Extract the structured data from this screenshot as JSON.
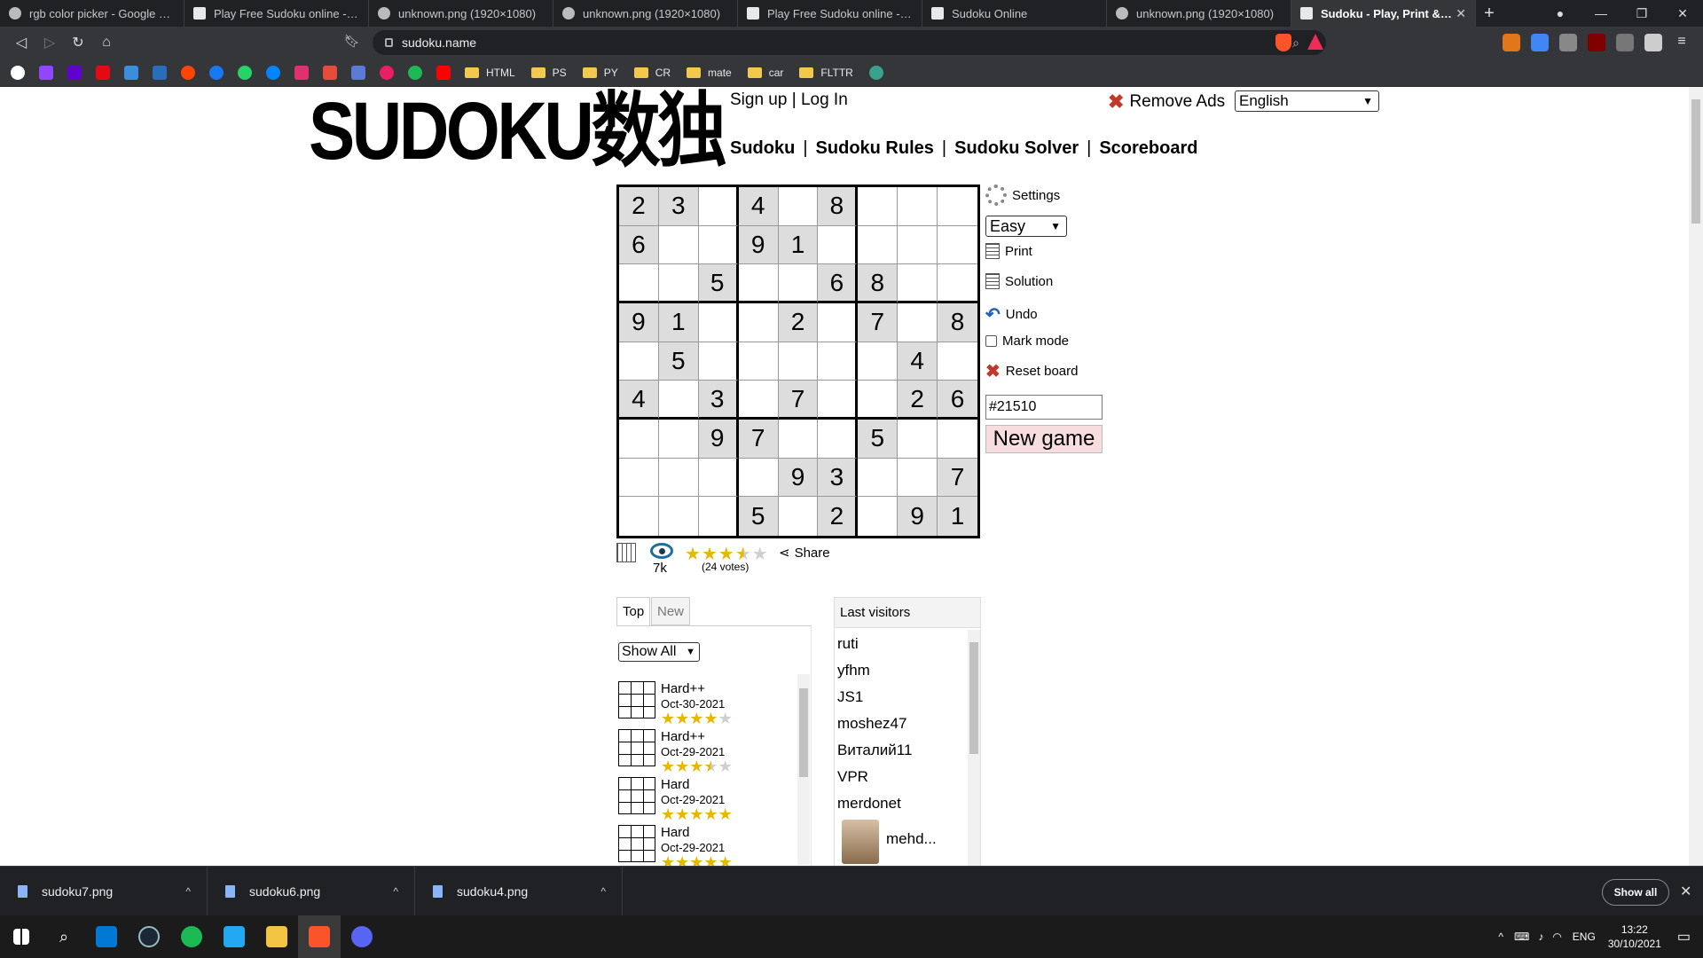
{
  "browser": {
    "tabs": [
      {
        "title": "rgb color picker - Google Search",
        "icon": "google-icon",
        "active": false
      },
      {
        "title": "Play Free Sudoku online - solve",
        "icon": "sudoku-site-icon",
        "active": false
      },
      {
        "title": "unknown.png (1920×1080)",
        "icon": "globe-icon",
        "active": false
      },
      {
        "title": "unknown.png (1920×1080)",
        "icon": "globe-icon",
        "active": false
      },
      {
        "title": "Play Free Sudoku online - solve",
        "icon": "sudoku-site-icon",
        "active": false
      },
      {
        "title": "Sudoku Online",
        "icon": "sudoku-site-icon",
        "active": false
      },
      {
        "title": "unknown.png (1920×1080)",
        "icon": "globe-icon",
        "active": false
      },
      {
        "title": "Sudoku - Play, Print & Share",
        "icon": "sudoku-site-icon",
        "active": true
      }
    ],
    "new_tab_glyph": "+",
    "url": "sudoku.name",
    "bookmarks_folders": [
      "HTML",
      "PS",
      "PY",
      "CR",
      "mate",
      "car",
      "FLTTR"
    ]
  },
  "site": {
    "logo_text": "SUDOKU数独",
    "auth": {
      "signup": "Sign up",
      "separator": "|",
      "login": "Log In"
    },
    "remove_ads": "Remove Ads",
    "language": "English",
    "nav": [
      "Sudoku",
      "Sudoku Rules",
      "Sudoku Solver",
      "Scoreboard"
    ]
  },
  "board": {
    "rows": [
      [
        "2",
        "3",
        "",
        "4",
        "",
        "8",
        "",
        "",
        ""
      ],
      [
        "6",
        "",
        "",
        "9",
        "1",
        "",
        "",
        "",
        ""
      ],
      [
        "",
        "",
        "5",
        "",
        "",
        "6",
        "8",
        "",
        ""
      ],
      [
        "9",
        "1",
        "",
        "",
        "2",
        "",
        "7",
        "",
        "8"
      ],
      [
        "",
        "5",
        "",
        "",
        "",
        "",
        "",
        "4",
        ""
      ],
      [
        "4",
        "",
        "3",
        "",
        "7",
        "",
        "",
        "2",
        "6"
      ],
      [
        "",
        "",
        "9",
        "7",
        "",
        "",
        "5",
        "",
        ""
      ],
      [
        "",
        "",
        "",
        "",
        "9",
        "3",
        "",
        "",
        "7"
      ],
      [
        "",
        "",
        "",
        "5",
        "",
        "2",
        "",
        "9",
        "1"
      ]
    ]
  },
  "controls": {
    "settings": "Settings",
    "difficulty": "Easy",
    "print": "Print",
    "solution": "Solution",
    "undo": "Undo",
    "mark_mode": "Mark mode",
    "reset_board": "Reset board",
    "game_id": "#21510",
    "new_game": "New game"
  },
  "stats": {
    "views": "7k",
    "rating": 3.5,
    "votes": "(24 votes)",
    "share": "Share"
  },
  "top_list": {
    "tabs": [
      "Top",
      "New"
    ],
    "filter": "Show All",
    "puzzles": [
      {
        "level": "Hard++",
        "date": "Oct-30-2021",
        "rating": 4
      },
      {
        "level": "Hard++",
        "date": "Oct-29-2021",
        "rating": 3.5
      },
      {
        "level": "Hard",
        "date": "Oct-29-2021",
        "rating": 5
      },
      {
        "level": "Hard",
        "date": "Oct-29-2021",
        "rating": 5
      }
    ]
  },
  "visitors": {
    "title": "Last visitors",
    "names": [
      "ruti",
      "yfhm",
      "JS1",
      "moshez47",
      "Виталий11",
      "VPR",
      "merdonet",
      "mehd..."
    ]
  },
  "downloads": {
    "files": [
      "sudoku7.png",
      "sudoku6.png",
      "sudoku4.png"
    ],
    "show_all": "Show all"
  },
  "taskbar": {
    "lang": "ENG",
    "time": "13:22",
    "date": "30/10/2021"
  }
}
